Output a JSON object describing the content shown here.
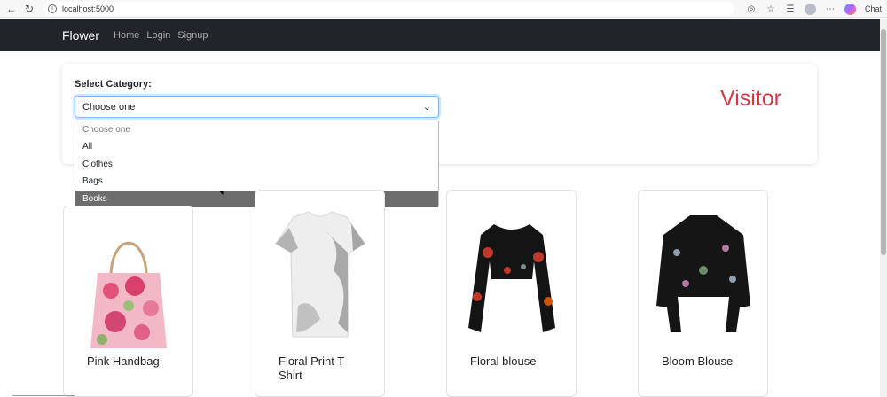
{
  "browser": {
    "url": "localhost:5000",
    "chat_label": "Chat"
  },
  "navbar": {
    "brand": "Flower",
    "links": [
      "Home",
      "Login",
      "Signup"
    ]
  },
  "filter": {
    "label": "Select Category:",
    "selected": "Choose one",
    "options": [
      "Choose one",
      "All",
      "Clothes",
      "Bags",
      "Books"
    ],
    "highlighted_option": "Books"
  },
  "role_badge": "Visitor",
  "colors": {
    "navbar_bg": "#212529",
    "visitor": "#dc3545",
    "focus_border": "#86b7fe"
  },
  "products": [
    {
      "title": "Pink Handbag",
      "price": ""
    },
    {
      "title": "Floral Print T-Shirt",
      "price": ""
    },
    {
      "title": "Floral blouse",
      "price": ""
    },
    {
      "title": "Bloom Blouse",
      "price": ""
    }
  ]
}
